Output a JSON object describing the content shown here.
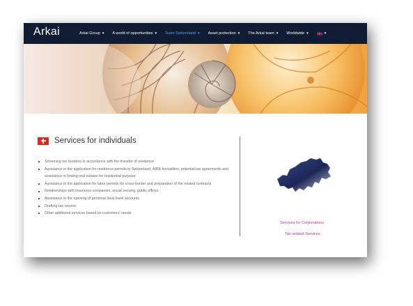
{
  "brand": {
    "logo": "Arkai"
  },
  "nav": {
    "items": [
      {
        "label": "Arkai Group",
        "active": false
      },
      {
        "label": "A world of opportunities",
        "active": false
      },
      {
        "label": "Team Switzerland",
        "active": true
      },
      {
        "label": "Asset protection",
        "active": false
      },
      {
        "label": "The Arkai team",
        "active": false
      },
      {
        "label": "Worldwide",
        "active": false
      }
    ],
    "language_icon": "uk-flag-icon",
    "chevron_icon": "chevron-down-icon",
    "active_color": "#4ea6e6"
  },
  "section": {
    "icon": "swiss-flag-icon",
    "title": "Services for individuals"
  },
  "services": [
    "Screening tax burdens in accordance with the transfer of residence",
    "Assistance in the application for residence permits in Switzerland, AIRE formalities, potential tax agreements and assistance in finding real estates for residential purpose",
    "Assistance in the application for labor permits for cross-border and preparation of the related contracts",
    "Relationships with insurance companies, social security, public offices",
    "Assistance in the opening of personal local bank accounts",
    "Drafting tax returns",
    "Other additional services based on customers' needs"
  ],
  "sidebar": {
    "map_icon": "switzerland-map-icon",
    "links": {
      "corporations": "Services for Corporations",
      "tax": "Tax-related Services"
    }
  },
  "colors": {
    "nav_bg": "#0f1c33",
    "link": "#b0339b",
    "swiss_red": "#d52b1e"
  }
}
